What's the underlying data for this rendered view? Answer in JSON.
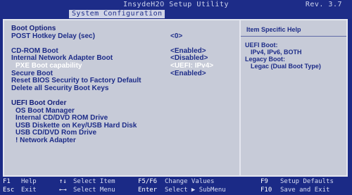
{
  "title": "InsydeH2O Setup Utility",
  "revision": "Rev. 3.7",
  "tab": "System Configuration",
  "settings": [
    {
      "label": "Boot Options",
      "value": "",
      "kind": "hdr",
      "indent": false
    },
    {
      "label": "POST Hotkey Delay (sec)",
      "value": "<0>",
      "kind": "item",
      "indent": false
    },
    {
      "label": "",
      "value": "",
      "kind": "blank",
      "indent": false
    },
    {
      "label": "CD-ROM Boot",
      "value": "<Enabled>",
      "kind": "item",
      "indent": false
    },
    {
      "label": "Internal Network Adapter Boot",
      "value": "<Disabled>",
      "kind": "item",
      "indent": false
    },
    {
      "label": "PXE Boot capability",
      "value": "<UEFI: IPv4>",
      "kind": "sel",
      "indent": true
    },
    {
      "label": "Secure Boot",
      "value": "<Enabled>",
      "kind": "item",
      "indent": false
    },
    {
      "label": "Reset BIOS Security to Factory Default",
      "value": "",
      "kind": "item",
      "indent": false
    },
    {
      "label": "Delete all Security Boot Keys",
      "value": "",
      "kind": "item",
      "indent": false
    },
    {
      "label": "",
      "value": "",
      "kind": "blank",
      "indent": false
    },
    {
      "label": "UEFI Boot Order",
      "value": "",
      "kind": "hdr",
      "indent": false
    },
    {
      "label": "OS Boot Manager",
      "value": "",
      "kind": "item",
      "indent": true
    },
    {
      "label": "Internal CD/DVD ROM Drive",
      "value": "",
      "kind": "item",
      "indent": true
    },
    {
      "label": "USB Diskette on Key/USB Hard Disk",
      "value": "",
      "kind": "item",
      "indent": true
    },
    {
      "label": "USB CD/DVD Rom Drive",
      "value": "",
      "kind": "item",
      "indent": true
    },
    {
      "label": "! Network Adapter",
      "value": "",
      "kind": "item",
      "indent": true
    }
  ],
  "help": {
    "title": "Item Specific Help",
    "lines": [
      {
        "text": "UEFI Boot:",
        "indent": false
      },
      {
        "text": "IPv4, IPv6, BOTH",
        "indent": true
      },
      {
        "text": "Legacy Boot:",
        "indent": false
      },
      {
        "text": "Legac (Dual Boot Type)",
        "indent": true
      }
    ]
  },
  "footer": [
    {
      "key": "F1",
      "action": "Help"
    },
    {
      "key": "Esc",
      "action": "Exit"
    },
    {
      "key": "↑↓",
      "action": "Select Item"
    },
    {
      "key": "←→",
      "action": "Select Menu"
    },
    {
      "key": "F5/F6",
      "action": "Change Values"
    },
    {
      "key": "Enter",
      "action": "Select ▶ SubMenu"
    },
    {
      "key": "F9",
      "action": "Setup Defaults"
    },
    {
      "key": "F10",
      "action": "Save and Exit"
    }
  ]
}
